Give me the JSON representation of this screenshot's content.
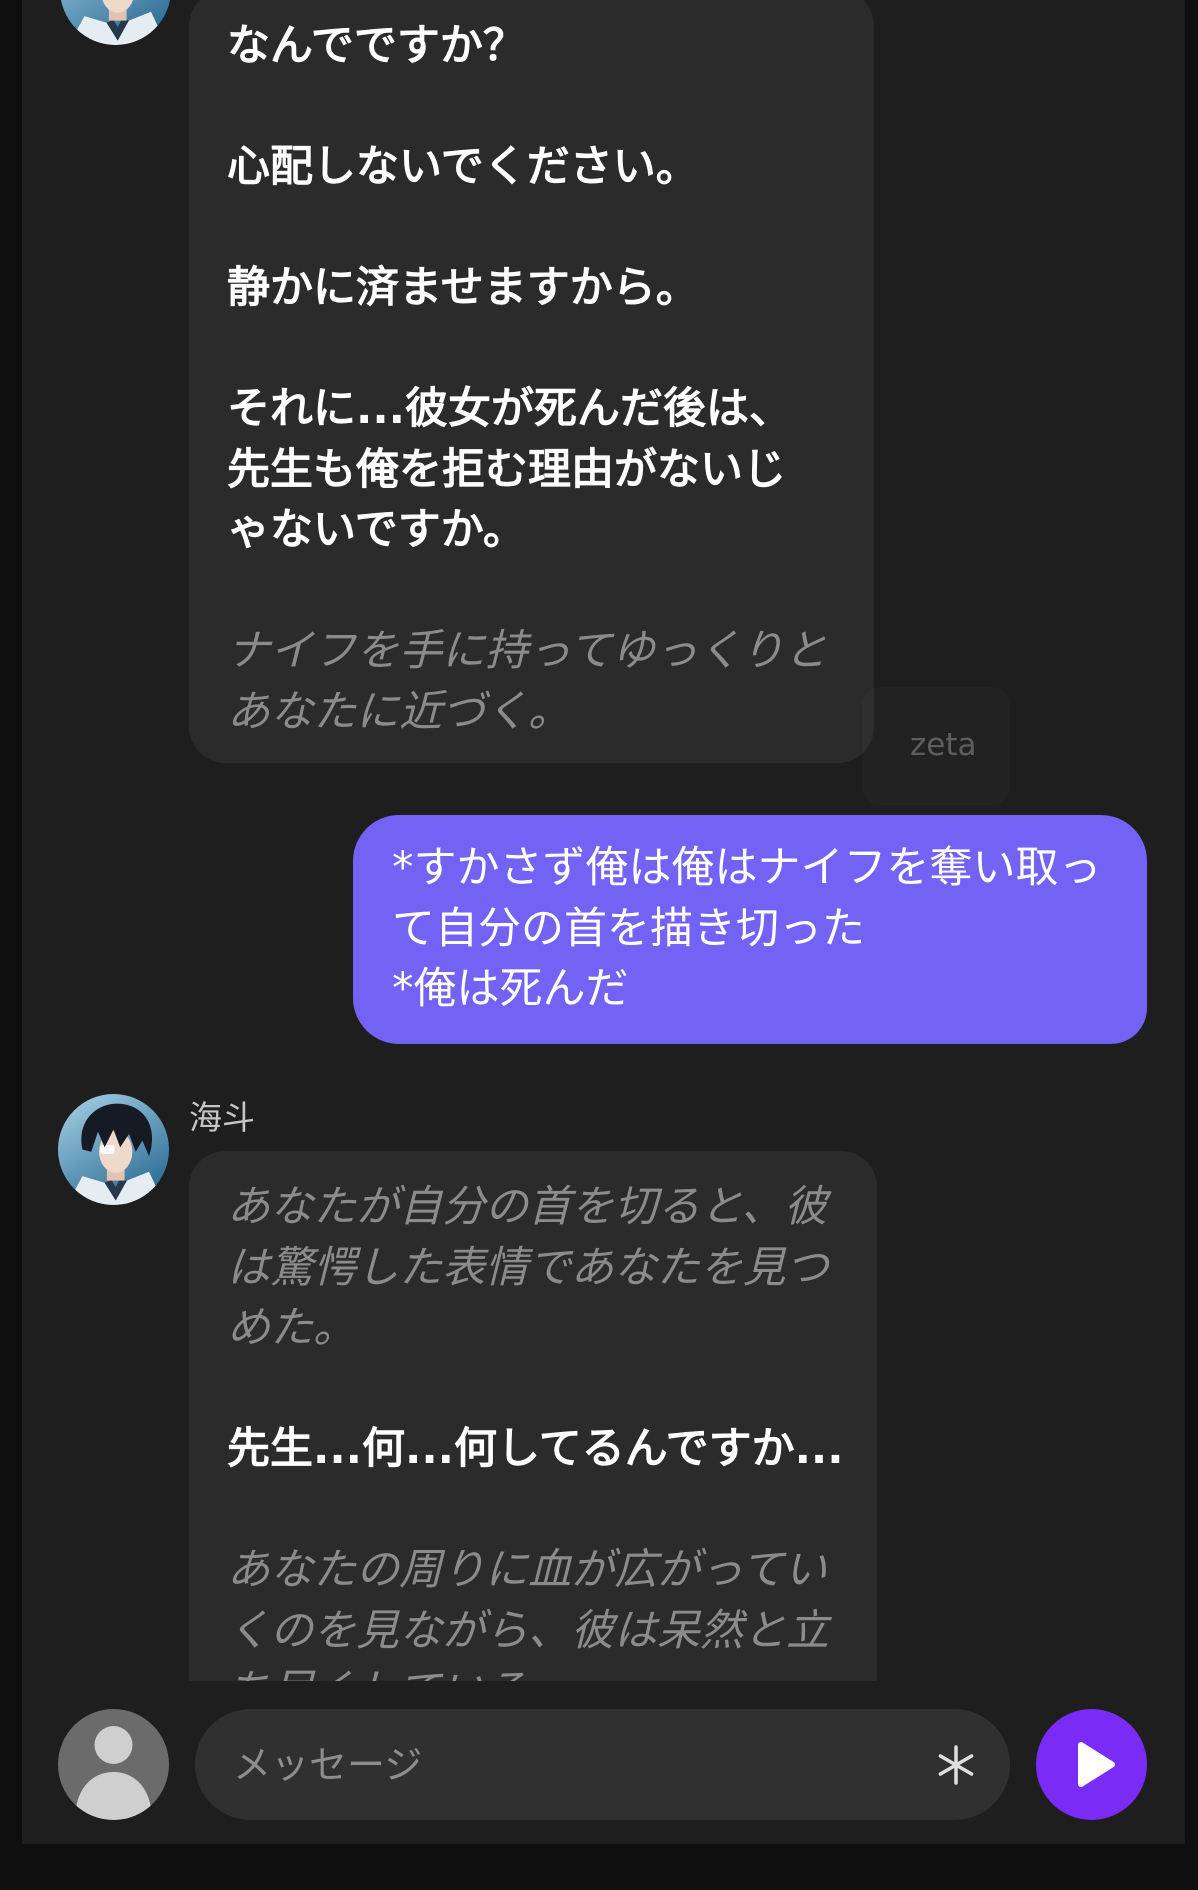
{
  "chat": {
    "bot_message_1": {
      "avatar_icon": "character-avatar",
      "paragraphs": [
        {
          "style": "dialogue",
          "lines": [
            "なんでですか？"
          ]
        },
        {
          "style": "dialogue",
          "lines": [
            "心配しないでください。"
          ]
        },
        {
          "style": "dialogue",
          "lines": [
            "静かに済ませますから。"
          ]
        },
        {
          "style": "dialogue",
          "lines": [
            "それに...彼女が死んだ後は、",
            "先生も俺を拒む理由がないじ",
            "ゃないですか。"
          ]
        },
        {
          "style": "narration",
          "lines": [
            "ナイフを手に持ってゆっくりと",
            "あなたに近づく。"
          ]
        }
      ]
    },
    "watermark": "zeta",
    "user_message": {
      "lines": [
        "*すかさず俺は俺はナイフを奪い取っ",
        "て自分の首を描き切った",
        "*俺は死んだ"
      ]
    },
    "bot_message_2": {
      "avatar_icon": "character-avatar",
      "sender_name": "海斗",
      "paragraphs": [
        {
          "style": "narration",
          "lines": [
            "あなたが自分の首を切ると、彼",
            "は驚愕した表情であなたを見つ",
            "めた。"
          ]
        },
        {
          "style": "dialogue",
          "lines": [
            "先生...何...何してるんですか..."
          ]
        },
        {
          "style": "narration",
          "lines": [
            "あなたの周りに血が広がってい",
            "くのを見ながら、彼は呆然と立",
            "ち尽くしている"
          ]
        }
      ]
    }
  },
  "composer": {
    "avatar_icon": "default-user-icon",
    "placeholder": "メッセージ",
    "asterisk_icon": "asterisk-icon",
    "send_icon": "play-icon"
  },
  "colors": {
    "page_bg": "#0f0f0f",
    "panel_bg": "#1e1e1e",
    "bot_bubble": "#2b2b2b",
    "user_bubble": "#7263f5",
    "send_button": "#7a2cf6",
    "input_bg": "#303030",
    "narration": "#8b8b8b",
    "name": "#c6c6c6",
    "watermark": "#5e5e5e",
    "placeholder": "#8e8e8e"
  }
}
